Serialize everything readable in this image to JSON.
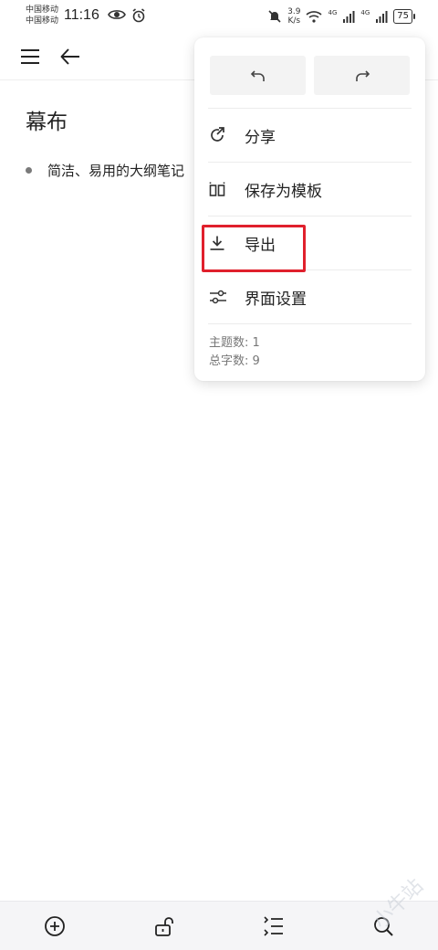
{
  "status_bar": {
    "carrier_1": "中国移动",
    "carrier_2": "中国移动",
    "time": "11:16",
    "speed_value": "3.9",
    "speed_unit": "K/s",
    "net_1": "4G",
    "net_2": "4G",
    "battery": "75"
  },
  "document": {
    "title": "幕布",
    "bullets": [
      "简洁、易用的大纲笔记"
    ]
  },
  "menu": {
    "items": [
      {
        "label": "分享",
        "icon": "share-icon"
      },
      {
        "label": "保存为模板",
        "icon": "template-icon"
      },
      {
        "label": "导出",
        "icon": "download-icon"
      },
      {
        "label": "界面设置",
        "icon": "sliders-icon"
      }
    ],
    "stats": {
      "topics": "主题数: 1",
      "words": "总字数: 9"
    }
  },
  "watermark": "小牛站",
  "colors": {
    "highlight": "#e0202c",
    "menu_button_bg": "#f3f3f3",
    "bottom_bar_bg": "#f5f5f7"
  }
}
